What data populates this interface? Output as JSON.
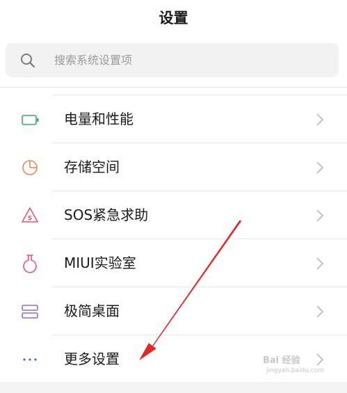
{
  "header": {
    "title": "设置"
  },
  "search": {
    "icon": "search-icon",
    "placeholder": "搜索系统设置项"
  },
  "rows": [
    {
      "label": "电量和性能",
      "icon": "battery-icon",
      "icon_color": "#3aa37a"
    },
    {
      "label": "存储空间",
      "icon": "pie-chart-icon",
      "icon_color": "#e8875a"
    },
    {
      "label": "SOS紧急求助",
      "icon": "sos-warning-icon",
      "icon_color": "#e0557a"
    },
    {
      "label": "MIUI实验室",
      "icon": "flask-icon",
      "icon_color": "#e0557a"
    },
    {
      "label": "极简桌面",
      "icon": "layout-icon",
      "icon_color": "#8a6fd1"
    },
    {
      "label": "更多设置",
      "icon": "more-dots-icon",
      "icon_color": "#3a6fc4"
    }
  ],
  "watermark": {
    "line1": "Bai 经验",
    "line2": "jingyan.baidu.com"
  },
  "colors": {
    "arrow": "#e82424",
    "chevron": "#b8b8b8"
  }
}
